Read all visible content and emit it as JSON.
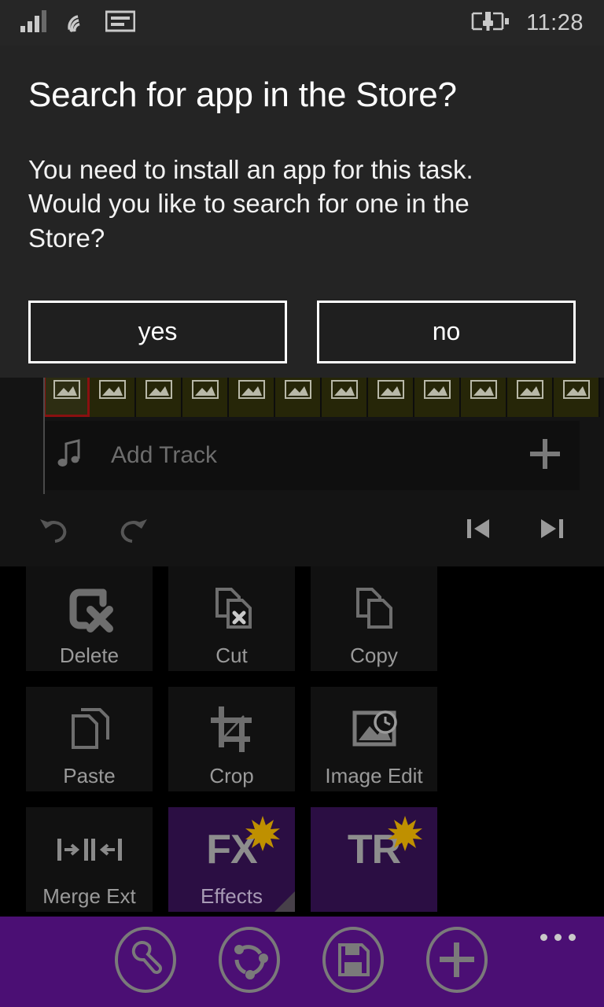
{
  "status_bar": {
    "signal_icon": "signal-bars-icon",
    "wifi_icon": "wifi-icon",
    "sim_icon": "sim-card-icon",
    "battery_icon": "battery-charging-icon",
    "time": "11:28"
  },
  "dialog": {
    "title": "Search for app in the Store?",
    "message": "You need to install an app for this task. Would you like to search for one in the Store?",
    "buttons": [
      {
        "label": "yes",
        "name": "yes-button"
      },
      {
        "label": "no",
        "name": "no-button"
      }
    ]
  },
  "editor": {
    "timeline": {
      "thumbnail_count": 12,
      "selected_index": 0,
      "selected_border_color": "#8a1010",
      "thumbnail_color": "#262608"
    },
    "add_track": {
      "icon": "music-note-icon",
      "label": "Add Track",
      "add_icon": "plus-icon"
    },
    "transport": {
      "undo": "undo-icon",
      "redo": "redo-icon",
      "skip_start": "skip-to-start-icon",
      "skip_end": "skip-to-end-icon"
    }
  },
  "tools": [
    {
      "label": "Delete",
      "icon": "delete-box-x-icon",
      "accent": false
    },
    {
      "label": "Cut",
      "icon": "cut-pages-x-icon",
      "accent": false
    },
    {
      "label": "Copy",
      "icon": "copy-pages-icon",
      "accent": false
    },
    {
      "label": "Paste",
      "icon": "paste-page-icon",
      "accent": false
    },
    {
      "label": "Crop",
      "icon": "crop-icon",
      "accent": false
    },
    {
      "label": "Image Edit",
      "icon": "image-clock-icon",
      "accent": false
    },
    {
      "label": "Merge Ext",
      "icon": "merge-arrows-icon",
      "accent": false
    },
    {
      "label": "Effects",
      "icon": "fx-star-icon",
      "accent": true
    },
    {
      "label": "",
      "icon": "tr-star-icon",
      "accent": true
    }
  ],
  "app_bar": {
    "background": "#4b0f74",
    "buttons": [
      {
        "name": "settings-button",
        "icon": "wrench-icon"
      },
      {
        "name": "share-button",
        "icon": "share-nodes-icon"
      },
      {
        "name": "save-button",
        "icon": "floppy-disk-icon"
      },
      {
        "name": "add-button",
        "icon": "plus-circle-icon"
      }
    ],
    "more_label": "..."
  },
  "colors": {
    "dialog_bg": "#242424",
    "status_bg": "#262626",
    "accent_purple": "#2b0e43",
    "appbar_purple": "#4b0f74",
    "star_gold": "#bf9000"
  }
}
